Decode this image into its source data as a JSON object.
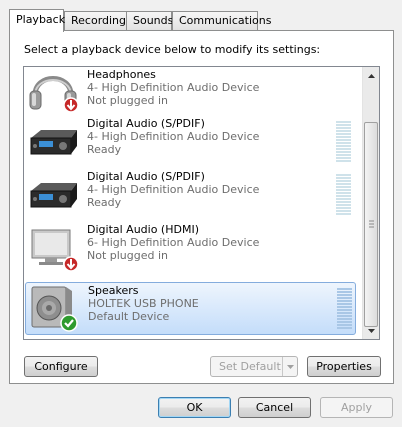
{
  "tabs": [
    "Playback",
    "Recording",
    "Sounds",
    "Communications"
  ],
  "instruction": "Select a playback device below to modify its settings:",
  "devices": [
    {
      "name": "Headphones",
      "line1": "4- High Definition Audio Device",
      "line2": "Not plugged in",
      "icon": "headphones-icon",
      "status": "not-plugged-in"
    },
    {
      "name": "Digital Audio (S/PDIF)",
      "line1": "4- High Definition Audio Device",
      "line2": "Ready",
      "icon": "receiver-icon",
      "status": "ready"
    },
    {
      "name": "Digital Audio (S/PDIF)",
      "line1": "4- High Definition Audio Device",
      "line2": "Ready",
      "icon": "receiver-icon",
      "status": "ready"
    },
    {
      "name": "Digital Audio (HDMI)",
      "line1": "6- High Definition Audio Device",
      "line2": "Not plugged in",
      "icon": "monitor-icon",
      "status": "not-plugged-in"
    },
    {
      "name": "Speakers",
      "line1": "HOLTEK USB PHONE",
      "line2": "Default Device",
      "icon": "speaker-icon",
      "status": "default",
      "selected": true
    }
  ],
  "buttons": {
    "configure": "Configure",
    "set_default": "Set Default",
    "properties": "Properties",
    "ok": "OK",
    "cancel": "Cancel",
    "apply": "Apply"
  }
}
